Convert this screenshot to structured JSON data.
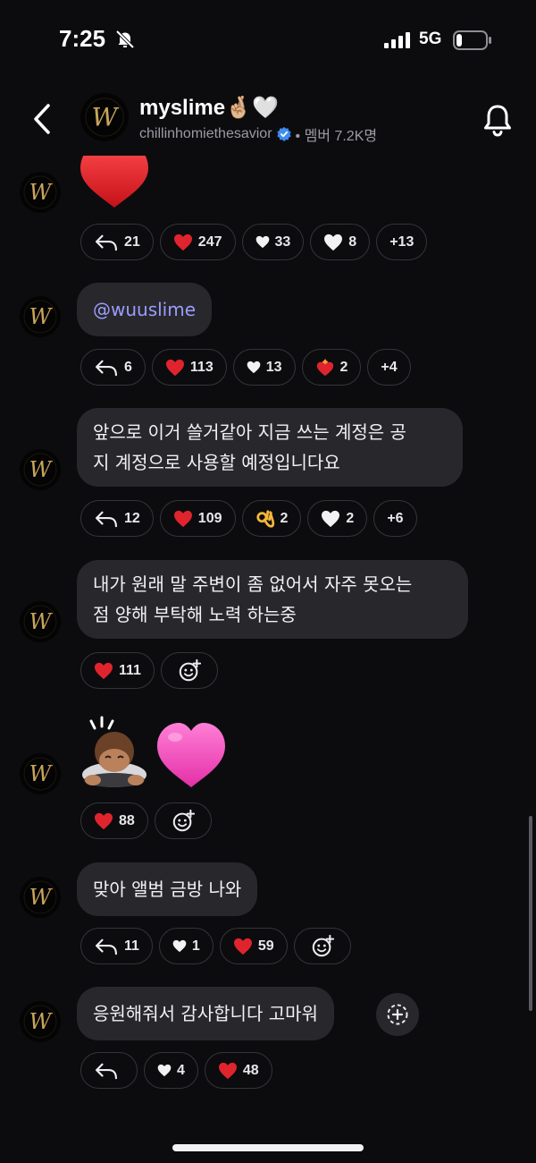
{
  "status_bar": {
    "time": "7:25",
    "network": "5G"
  },
  "header": {
    "title": "myslime🤞🏼🤍",
    "handle": "chillinhomiethesavior",
    "member_label": "• 멤버 7.2K명"
  },
  "colors": {
    "background": "#0c0c0f",
    "bubble": "#28282c",
    "mention": "#9c9cff",
    "heart": "#e0242e",
    "chip_border": "#34343a"
  },
  "messages": [
    {
      "emoji": "❤️",
      "reactions": [
        {
          "icon": "reply-icon",
          "count": "21"
        },
        {
          "icon": "❤️",
          "count": "247"
        },
        {
          "icon": "♥",
          "count": "33"
        },
        {
          "icon": "🤍",
          "count": "8"
        },
        {
          "icon": "",
          "count": "+13"
        }
      ]
    },
    {
      "text": "@wuuslime",
      "reactions": [
        {
          "icon": "reply-icon",
          "count": "6"
        },
        {
          "icon": "❤️",
          "count": "113"
        },
        {
          "icon": "♥",
          "count": "13"
        },
        {
          "icon": "❤️‍🔥",
          "count": "2"
        },
        {
          "icon": "",
          "count": "+4"
        }
      ]
    },
    {
      "lines": [
        "앞으로 이거 쓸거같아 지금 쓰는 계정은 공",
        "지 계정으로 사용할 예정입니다요"
      ],
      "reactions": [
        {
          "icon": "reply-icon",
          "count": "12"
        },
        {
          "icon": "❤️",
          "count": "109"
        },
        {
          "icon": "👌",
          "count": "2"
        },
        {
          "icon": "🤍",
          "count": "2"
        },
        {
          "icon": "",
          "count": "+6"
        }
      ]
    },
    {
      "lines": [
        "내가 원래 말 주변이 좀 없어서 자주 못오는",
        "점 양해 부탁해 노력 하는중"
      ],
      "reactions": [
        {
          "icon": "❤️",
          "count": "111"
        }
      ]
    },
    {
      "emoji": "🙇🏽 💗",
      "reactions": [
        {
          "icon": "❤️",
          "count": "88"
        }
      ]
    },
    {
      "text": "맞아 앨범 금방 나와",
      "reactions": [
        {
          "icon": "reply-icon",
          "count": "11"
        },
        {
          "icon": "♥",
          "count": "1"
        },
        {
          "icon": "❤️",
          "count": "59"
        }
      ]
    },
    {
      "text": "응원해줘서 감사합니다 고마워",
      "reactions": [
        {
          "icon": "reply-icon",
          "count": ""
        },
        {
          "icon": "♥",
          "count": "4"
        },
        {
          "icon": "❤️",
          "count": "48"
        }
      ]
    }
  ]
}
